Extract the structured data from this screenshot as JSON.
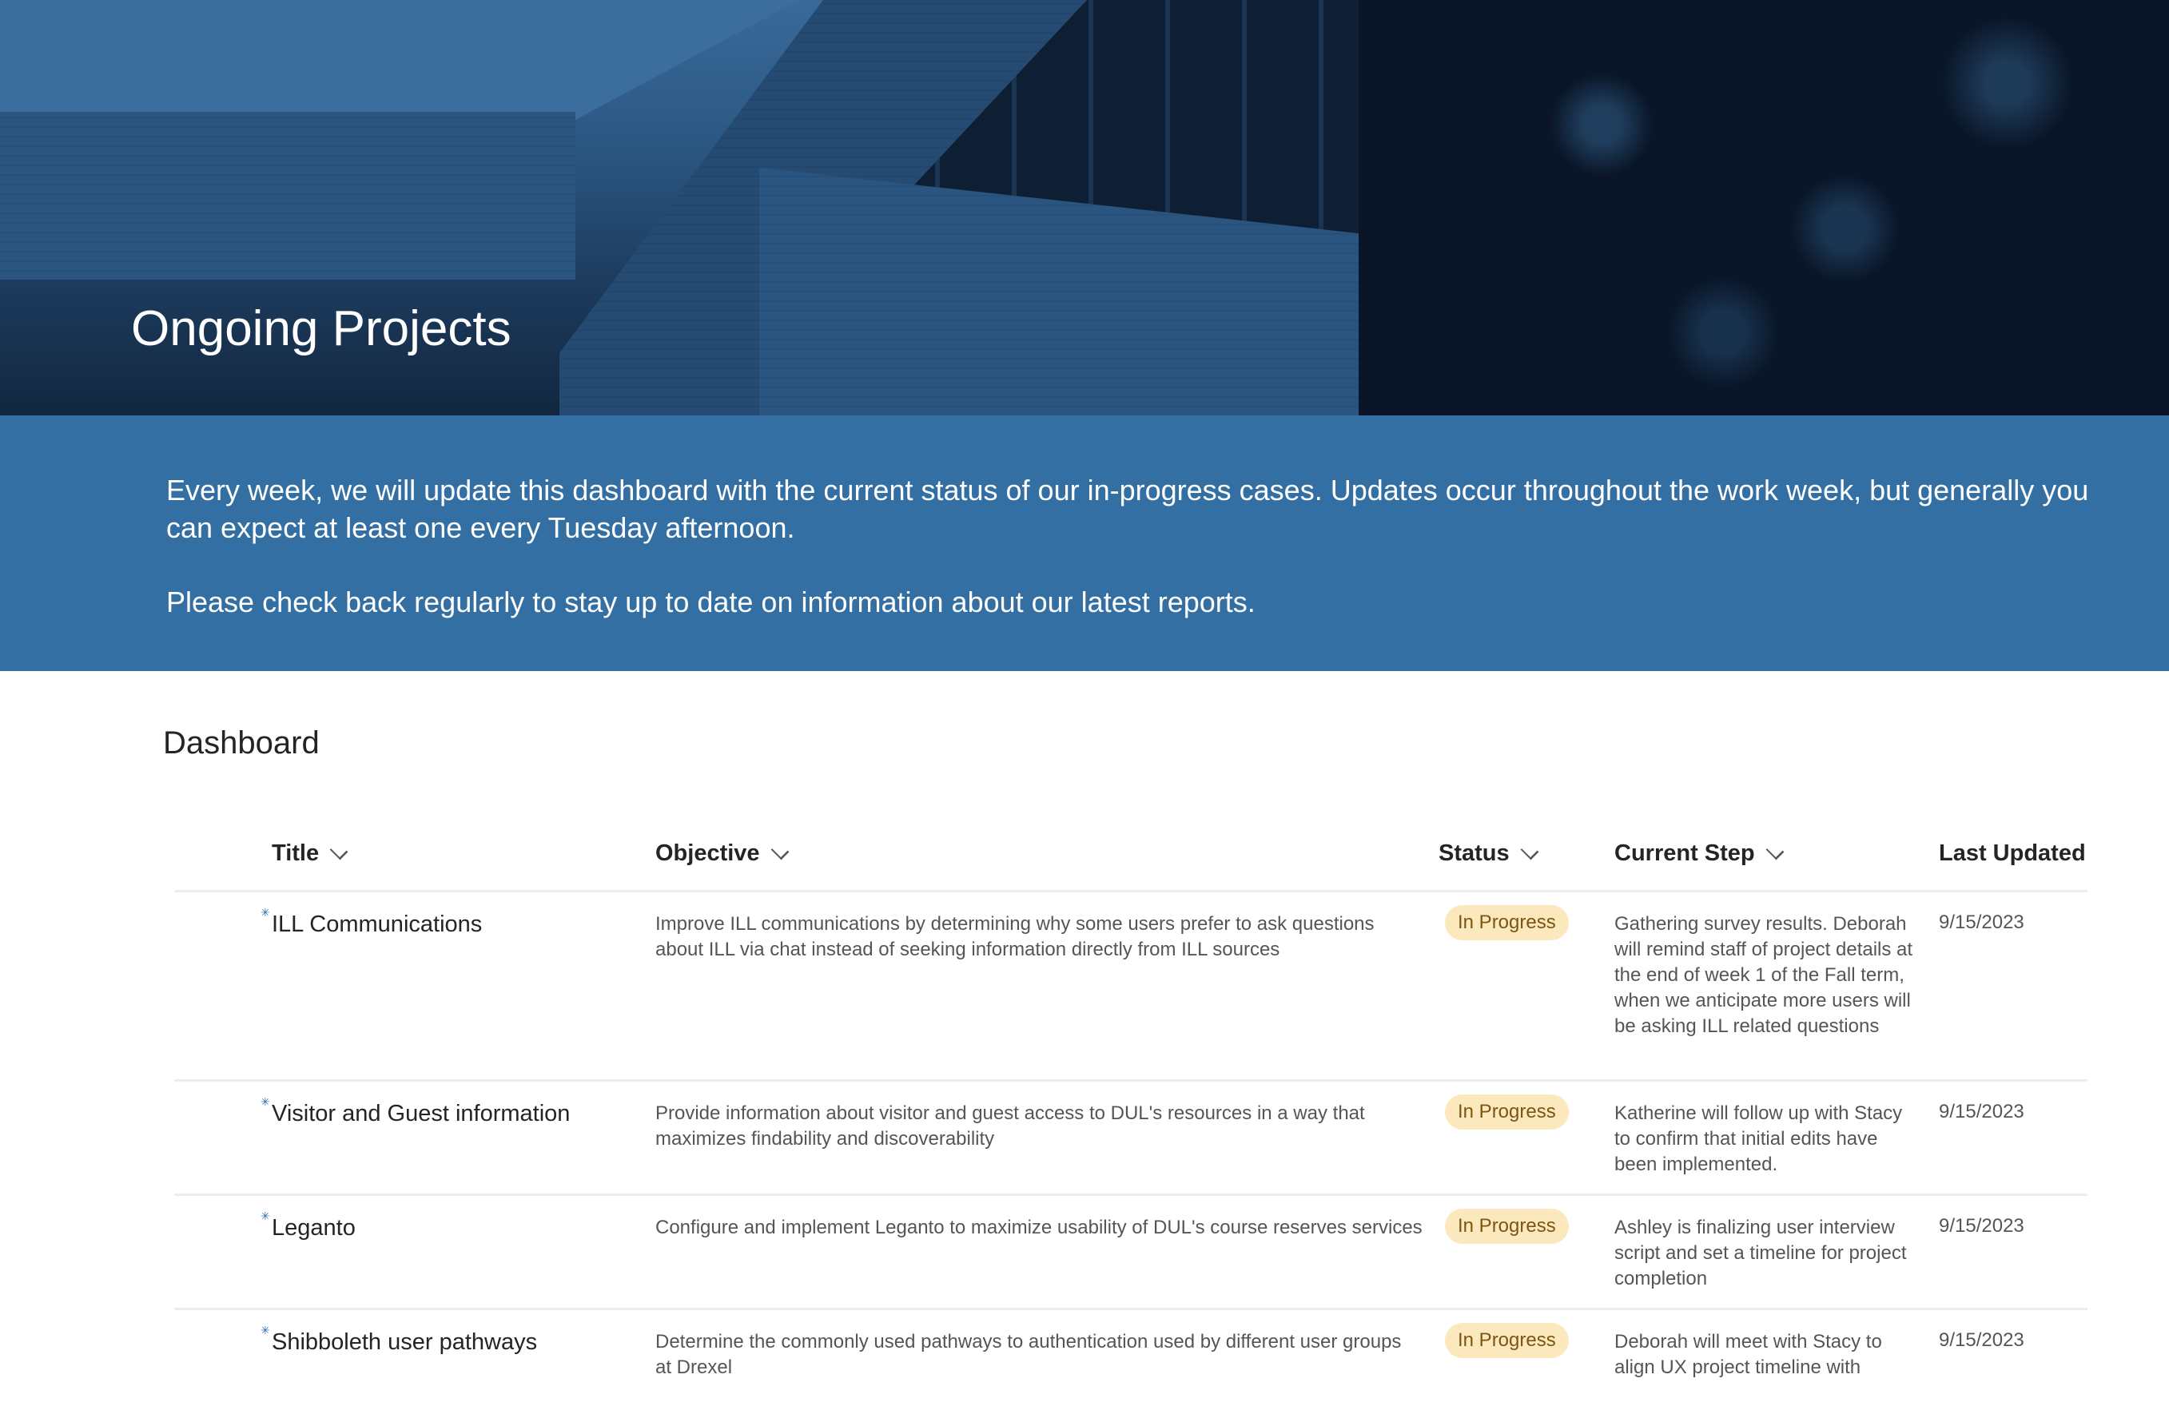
{
  "hero": {
    "title": "Ongoing Projects"
  },
  "intro": {
    "paragraph1": "Every week, we will update this dashboard with the current status of our in-progress cases. Updates occur throughout the work week, but generally you can expect at least one every Tuesday afternoon.",
    "paragraph2": "Please check back regularly to stay up to date on information about our latest reports."
  },
  "dashboard": {
    "title": "Dashboard",
    "columns": [
      {
        "label": "Title",
        "sortable": true
      },
      {
        "label": "Objective",
        "sortable": true
      },
      {
        "label": "Status",
        "sortable": true
      },
      {
        "label": "Current Step",
        "sortable": true
      },
      {
        "label": "Last Updated",
        "sortable": false
      }
    ],
    "rows": [
      {
        "title": "ILL Communications",
        "new_icon": "new-item-sparkle-icon",
        "objective": "Improve ILL communications by determining why some users prefer to ask questions about ILL via chat instead of seeking information directly from ILL sources",
        "status": "In Progress",
        "current_step": "Gathering survey results. Deborah will remind staff of project details at the end of week 1 of the Fall term, when we anticipate more users will be asking ILL related questions",
        "last_updated": "9/15/2023"
      },
      {
        "title": "Visitor and Guest information",
        "new_icon": "new-item-sparkle-icon",
        "objective": "Provide information about visitor and guest access to DUL's resources in a way that maximizes findability and discoverability",
        "status": "In Progress",
        "current_step": "Katherine will follow up with Stacy to confirm that initial edits have been implemented.",
        "last_updated": "9/15/2023"
      },
      {
        "title": "Leganto",
        "new_icon": "new-item-sparkle-icon",
        "objective": "Configure and implement Leganto to maximize usability of DUL's course reserves services",
        "status": "In Progress",
        "current_step": "Ashley is finalizing user interview script and set a timeline for project completion",
        "last_updated": "9/15/2023"
      },
      {
        "title": "Shibboleth user pathways",
        "new_icon": "new-item-sparkle-icon",
        "objective": "Determine the commonly used pathways to authentication used by different user groups at Drexel",
        "status": "In Progress",
        "current_step": "Deborah will meet with Stacy to align UX project timeline with",
        "last_updated": "9/15/2023"
      }
    ]
  },
  "colors": {
    "intro_band": "#336fa3",
    "status_badge_bg": "#fbe8bd",
    "status_badge_text": "#7a5613",
    "new_icon": "#2b6cb0"
  }
}
